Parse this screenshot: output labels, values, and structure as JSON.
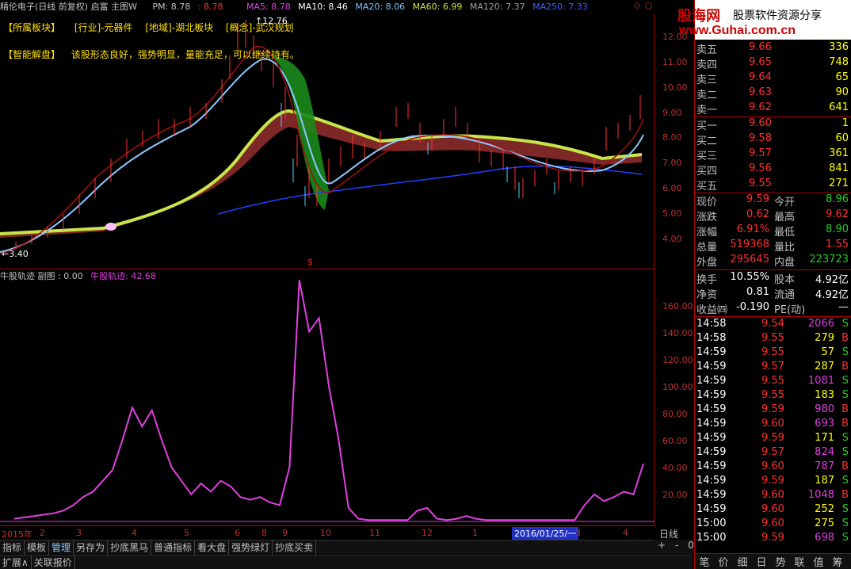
{
  "window": {
    "title": "精伦电子(日线 前复权) 启富 主图W"
  },
  "ma": {
    "pm": "PM: 8.78",
    "pm_val": ": 8.78",
    "ma5": "MA5: 8.78",
    "ma10": "MA10: 8.46",
    "ma20": "MA20: 8.06",
    "ma60": "MA60: 6.99",
    "ma120": "MA120: 7.37",
    "ma250": "MA250: 7.33"
  },
  "info": {
    "sector": "【所属板块】",
    "industry": "[行业]-元器件",
    "region": "[地域]-湖北板块",
    "concept": "[概念]-武汉规划",
    "analysis_label": "【智能解盘】",
    "analysis_text": "该股形态良好，强势明显，量能充足，可以继续持有。",
    "high_marker": "12.76",
    "low_marker": "3.40"
  },
  "price_axis": [
    "12.00",
    "11.00",
    "10.00",
    "9.00",
    "8.00",
    "7.00",
    "6.00",
    "5.00",
    "4.00"
  ],
  "sub": {
    "title": "牛股轨迹 副图 : 0.00",
    "series_label": "牛股轨迹: 42.68",
    "axis": [
      "160.00",
      "140.00",
      "120.00",
      "100.00",
      "80.00",
      "60.00",
      "40.00",
      "20.00"
    ]
  },
  "dates": {
    "year": "2015年",
    "months": [
      "2",
      "3",
      "4",
      "5",
      "6",
      "8",
      "9",
      "10",
      "11",
      "12",
      "1",
      "3",
      "4"
    ],
    "cursor": "2016/01/25/一",
    "period": "日线"
  },
  "tabs": [
    "指标",
    "模板",
    "管理",
    "另存为",
    "抄底黑马",
    "普通指标",
    "看大盘",
    "强势绿灯",
    "抄底买卖"
  ],
  "bottom": {
    "expand": "扩展∧",
    "related": "关联报价",
    "zoom": [
      "+",
      "-",
      "0"
    ]
  },
  "logo": {
    "brand": "股海网",
    "slogan": "股票软件资源分享",
    "url": "www.Guhai.com.cn"
  },
  "asks": [
    {
      "label": "卖五",
      "price": "9.66",
      "vol": "336"
    },
    {
      "label": "卖四",
      "price": "9.65",
      "vol": "748"
    },
    {
      "label": "卖三",
      "price": "9.64",
      "vol": "65"
    },
    {
      "label": "卖二",
      "price": "9.63",
      "vol": "90"
    },
    {
      "label": "卖一",
      "price": "9.62",
      "vol": "641"
    }
  ],
  "bids": [
    {
      "label": "买一",
      "price": "9.60",
      "vol": "1"
    },
    {
      "label": "买二",
      "price": "9.58",
      "vol": "60"
    },
    {
      "label": "买三",
      "price": "9.57",
      "vol": "361"
    },
    {
      "label": "买四",
      "price": "9.56",
      "vol": "841"
    },
    {
      "label": "买五",
      "price": "9.55",
      "vol": "271"
    }
  ],
  "stats": [
    {
      "l1": "现价",
      "v1": "9.59",
      "l2": "今开",
      "v2": "8.96"
    },
    {
      "l1": "涨跌",
      "v1": "0.62",
      "l2": "最高",
      "v2": "9.62"
    },
    {
      "l1": "涨幅",
      "v1": "6.91%",
      "l2": "最低",
      "v2": "8.90"
    },
    {
      "l1": "总量",
      "v1": "519368",
      "l2": "量比",
      "v2": "1.55"
    },
    {
      "l1": "外盘",
      "v1": "295645",
      "l2": "内盘",
      "v2": "223723"
    }
  ],
  "stats2": [
    {
      "l1": "换手",
      "v1": "10.55%",
      "l2": "股本",
      "v2": "4.92亿"
    },
    {
      "l1": "净资",
      "v1": "0.81",
      "l2": "流通",
      "v2": "4.92亿"
    },
    {
      "l1": "收益㈣",
      "v1": "-0.190",
      "l2": "PE(动)",
      "v2": "—"
    }
  ],
  "ticks": [
    {
      "t": "14:58",
      "p": "9.54",
      "v": "2066",
      "s": "S"
    },
    {
      "t": "14:58",
      "p": "9.55",
      "v": "279",
      "s": "B"
    },
    {
      "t": "14:59",
      "p": "9.55",
      "v": "57",
      "s": "S"
    },
    {
      "t": "14:59",
      "p": "9.57",
      "v": "287",
      "s": "B"
    },
    {
      "t": "14:59",
      "p": "9.55",
      "v": "1081",
      "s": "S"
    },
    {
      "t": "14:59",
      "p": "9.55",
      "v": "183",
      "s": "S"
    },
    {
      "t": "14:59",
      "p": "9.59",
      "v": "980",
      "s": "B"
    },
    {
      "t": "14:59",
      "p": "9.60",
      "v": "693",
      "s": "B"
    },
    {
      "t": "14:59",
      "p": "9.59",
      "v": "171",
      "s": "S"
    },
    {
      "t": "14:59",
      "p": "9.57",
      "v": "824",
      "s": "S"
    },
    {
      "t": "14:59",
      "p": "9.60",
      "v": "787",
      "s": "B"
    },
    {
      "t": "14:59",
      "p": "9.59",
      "v": "187",
      "s": "S"
    },
    {
      "t": "14:59",
      "p": "9.60",
      "v": "1048",
      "s": "B"
    },
    {
      "t": "14:59",
      "p": "9.60",
      "v": "252",
      "s": "S"
    },
    {
      "t": "15:00",
      "p": "9.60",
      "v": "275",
      "s": "S"
    },
    {
      "t": "15:00",
      "p": "9.59",
      "v": "698",
      "s": "S"
    }
  ],
  "right_tabs": [
    "笔",
    "价",
    "细",
    "日",
    "势",
    "联",
    "值",
    "筹"
  ],
  "chart_data": {
    "type": "line",
    "title": "牛股轨迹",
    "ylim": [
      0,
      180
    ],
    "series": [
      {
        "name": "牛股轨迹",
        "values": [
          2,
          3,
          4,
          5,
          6,
          8,
          12,
          18,
          22,
          30,
          38,
          60,
          84,
          70,
          82,
          60,
          40,
          30,
          20,
          28,
          22,
          30,
          26,
          18,
          16,
          18,
          14,
          12,
          40,
          178,
          140,
          150,
          100,
          60,
          10,
          2,
          1,
          1,
          1,
          1,
          1,
          8,
          10,
          2,
          1,
          2,
          4,
          2,
          1,
          1,
          1,
          1,
          1,
          1,
          1,
          1,
          1,
          1,
          12,
          20,
          15,
          18,
          22,
          20,
          42.68
        ]
      }
    ]
  }
}
